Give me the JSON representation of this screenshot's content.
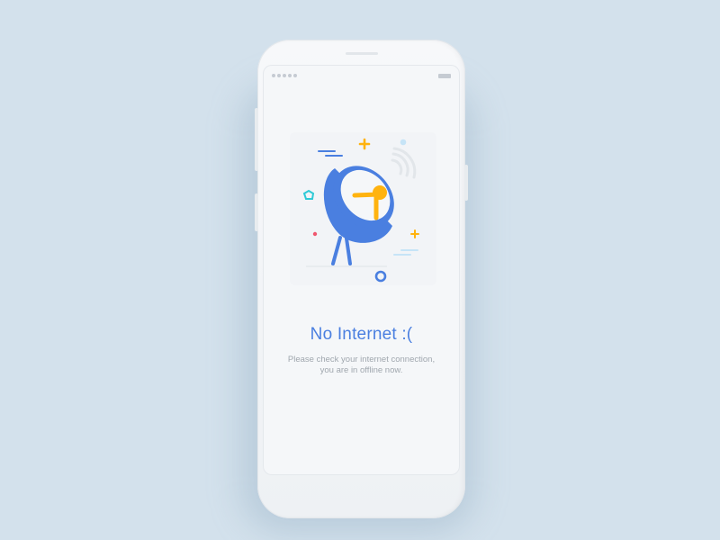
{
  "screen": {
    "title": "No Internet :(",
    "message_line1": "Please check your internet connection,",
    "message_line2": "you are in offline now."
  },
  "illustration": {
    "icon": "satellite-dish-icon",
    "colors": {
      "dish": "#4a7fe0",
      "accent": "#ffb30f",
      "signal": "#e2e6ea",
      "pentagon": "#2ec9d6",
      "dot": "#f0566e",
      "ring": "#4a7fe0",
      "circle": "#c6e4f7"
    }
  },
  "theme": {
    "background": "#d3e1ec",
    "title_color": "#4a7fe0",
    "text_color": "#a0a7ae"
  }
}
